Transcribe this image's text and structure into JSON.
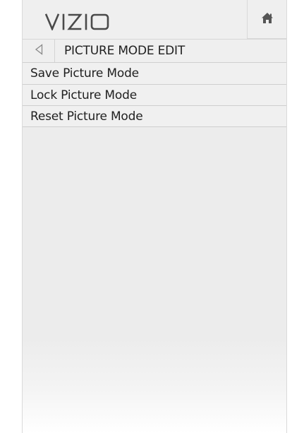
{
  "header": {
    "logo_text": "VIZIO",
    "home_icon": "home-icon"
  },
  "title_bar": {
    "back_icon": "back-arrow-icon",
    "title": "PICTURE MODE EDIT"
  },
  "menu": {
    "items": [
      {
        "label": "Save Picture Mode"
      },
      {
        "label": "Lock Picture Mode"
      },
      {
        "label": "Reset Picture Mode"
      }
    ]
  }
}
